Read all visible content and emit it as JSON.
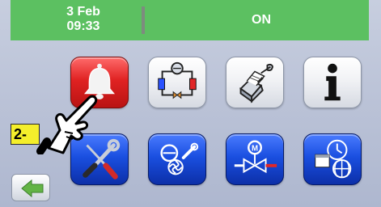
{
  "header": {
    "date": "3 Feb",
    "time": "09:33",
    "status": "ON"
  },
  "annotation": {
    "step_label": "2-"
  },
  "colors": {
    "header_green": "#5cc061",
    "alarm_red": "#e02222",
    "menu_blue": "#1a4fe0",
    "step_yellow": "#f4ee2b"
  },
  "menu": {
    "row1": [
      {
        "name": "alarm",
        "icon": "bell-icon"
      },
      {
        "name": "refrigeration-circuit",
        "icon": "refrigeration-circuit-icon"
      },
      {
        "name": "service",
        "icon": "wrench-manual-icon"
      },
      {
        "name": "info",
        "icon": "info-icon"
      }
    ],
    "row2": [
      {
        "name": "tools",
        "icon": "screwdriver-wrench-icon"
      },
      {
        "name": "compressor-fan-settings",
        "icon": "compressor-fan-icon"
      },
      {
        "name": "valve-settings",
        "icon": "motor-valve-icon"
      },
      {
        "name": "clock-calendar-network",
        "icon": "clock-calendar-globe-icon"
      }
    ]
  },
  "footer": {
    "back_icon": "arrow-left-icon"
  }
}
